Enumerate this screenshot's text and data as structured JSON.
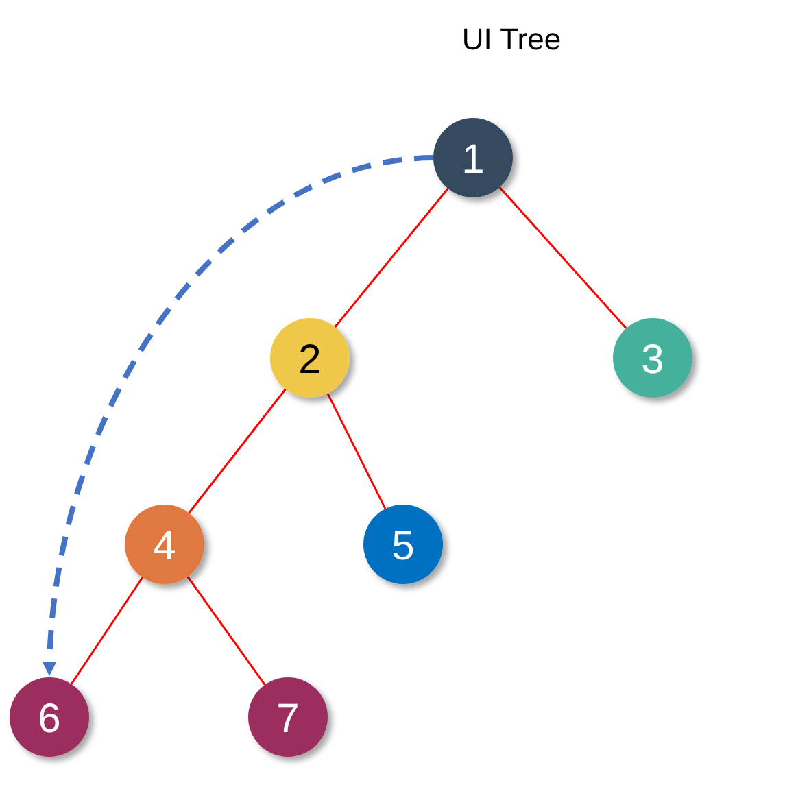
{
  "title": "UI Tree",
  "tree": {
    "label": "1",
    "color": "#344a5e",
    "children": [
      {
        "label": "2",
        "color": "#f0c84a",
        "children": [
          {
            "label": "4",
            "color": "#e07840",
            "children": [
              {
                "label": "6",
                "color": "#9c2e5e"
              },
              {
                "label": "7",
                "color": "#9c2e5e"
              }
            ]
          },
          {
            "label": "5",
            "color": "#0070c0"
          }
        ]
      },
      {
        "label": "3",
        "color": "#45b09c"
      }
    ]
  }
}
